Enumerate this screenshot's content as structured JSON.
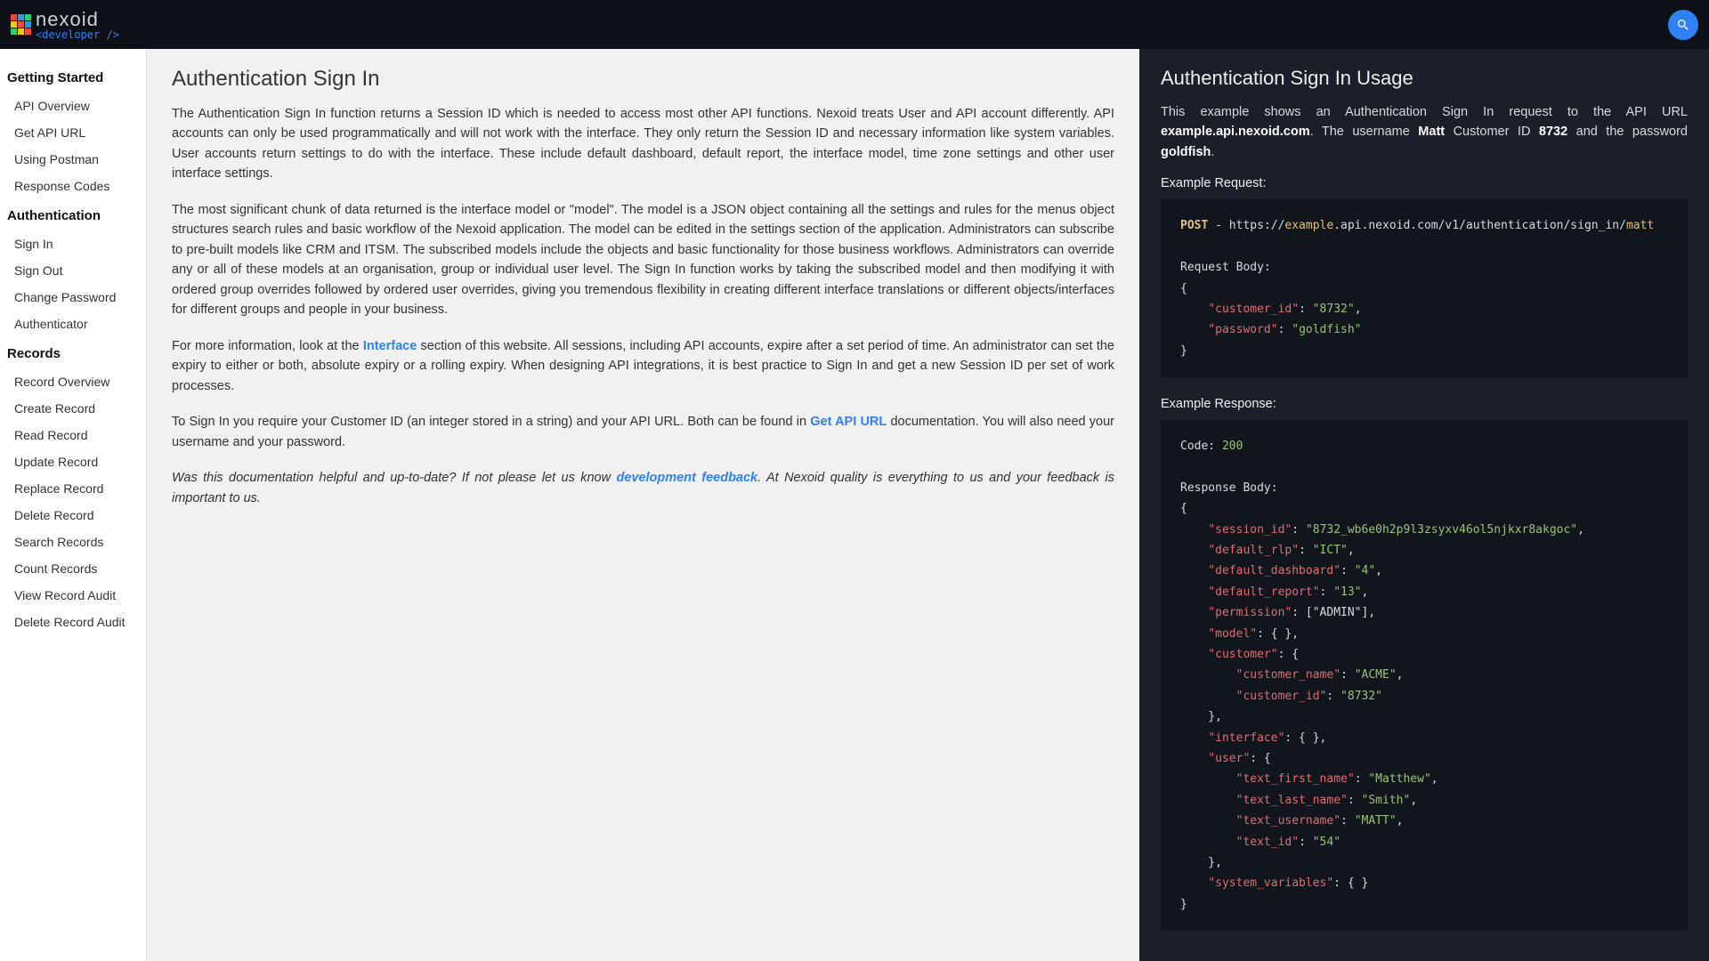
{
  "brand": {
    "name": "nexoid",
    "sub": "<developer />"
  },
  "sidebar": {
    "groups": [
      {
        "title": "Getting Started",
        "items": [
          "API Overview",
          "Get API URL",
          "Using Postman",
          "Response Codes"
        ]
      },
      {
        "title": "Authentication",
        "items": [
          "Sign In",
          "Sign Out",
          "Change Password",
          "Authenticator"
        ]
      },
      {
        "title": "Records",
        "items": [
          "Record Overview",
          "Create Record",
          "Read Record",
          "Update Record",
          "Replace Record",
          "Delete Record",
          "Search Records",
          "Count Records",
          "View Record Audit",
          "Delete Record Audit"
        ]
      }
    ]
  },
  "main": {
    "title": "Authentication Sign In",
    "p1": "The Authentication Sign In function returns a Session ID which is needed to access most other API functions. Nexoid treats User and API account differently. API accounts can only be used programmatically and will not work with the interface. They only return the Session ID and necessary information like system variables. User accounts return settings to do with the interface. These include default dashboard, default report, the interface model, time zone settings and other user interface settings.",
    "p2": "The most significant chunk of data returned is the interface model or \"model\". The model is a JSON object containing all the settings and rules for the menus object structures search rules and basic workflow of the Nexoid application. The model can be edited in the settings section of the application. Administrators can subscribe to pre-built models like CRM and ITSM. The subscribed models include the objects and basic functionality for those business workflows. Administrators can override any or all of these models at an organisation, group or individual user level. The Sign In function works by taking the subscribed model and then modifying it with ordered group overrides followed by ordered user overrides, giving you tremendous flexibility in creating different interface translations or different objects/interfaces for different groups and people in your business.",
    "p3a": "For more information, look at the ",
    "p3_link": "Interface",
    "p3b": " section of this website. All sessions, including API accounts, expire after a set period of time. An administrator can set the expiry to either or both, absolute expiry or a rolling expiry. When designing API integrations, it is best practice to Sign In and get a new Session ID per set of work processes.",
    "p4a": "To Sign In you require your Customer ID (an integer stored in a string) and your API URL. Both can be found in ",
    "p4_link": "Get API URL",
    "p4b": " documentation. You will also need your username and your password.",
    "feedback_a": "Was this documentation helpful and up-to-date? If not please let us know ",
    "feedback_link": "development feedback",
    "feedback_b": ". At Nexoid quality is everything to us and your feedback is important to us."
  },
  "usage": {
    "title": "Authentication Sign In Usage",
    "intro_a": "This example shows an Authentication Sign In request to the API URL ",
    "intro_url": "example.api.nexoid.com",
    "intro_b": ". The username ",
    "intro_user": "Matt",
    "intro_c": " Customer ID ",
    "intro_cid": "8732",
    "intro_d": " and the password ",
    "intro_pwd": "goldfish",
    "intro_e": ".",
    "req_label": "Example Request:",
    "req_method": "POST",
    "req_url_pre": " - https://",
    "req_url_host": "example",
    "req_url_rest": ".api.nexoid.com/v1/authentication/sign_in/",
    "req_url_user": "matt",
    "req_body_label": "Request Body:",
    "req_body_json": {
      "customer_id": "\"8732\"",
      "password": "\"goldfish\""
    },
    "resp_label": "Example Response:",
    "resp_code_label": "Code: ",
    "resp_code": "200",
    "resp_body_label": "Response Body:",
    "resp": {
      "session_id": "\"8732_wb6e0h2p9l3zsyxv46ol5njkxr8akgoc\"",
      "default_rlp": "\"ICT\"",
      "default_dashboard": "\"4\"",
      "default_report": "\"13\"",
      "permission": "[\"ADMIN\"]",
      "model": "{ }",
      "customer_name": "\"ACME\"",
      "customer_id": "\"8732\"",
      "interface": "{ }",
      "text_first_name": "\"Matthew\"",
      "text_last_name": "\"Smith\"",
      "text_username": "\"MATT\"",
      "text_id": "\"54\"",
      "system_variables": "{ }"
    }
  }
}
